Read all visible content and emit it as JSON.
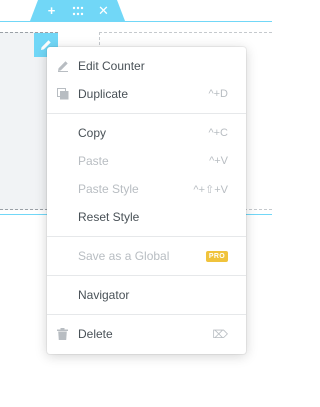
{
  "section_handle": {
    "add_glyph": "+",
    "drag_glyph": "⋮⋮",
    "close_glyph": "✕"
  },
  "context_menu": {
    "groups": [
      {
        "items": [
          {
            "label": "Edit Counter",
            "shortcut": "",
            "icon": "pencil-icon",
            "disabled": false
          },
          {
            "label": "Duplicate",
            "shortcut": "^+D",
            "icon": "duplicate-icon",
            "disabled": false
          }
        ]
      },
      {
        "items": [
          {
            "label": "Copy",
            "shortcut": "^+C",
            "disabled": false
          },
          {
            "label": "Paste",
            "shortcut": "^+V",
            "disabled": true
          },
          {
            "label": "Paste Style",
            "shortcut": "^+⇧+V",
            "disabled": true
          },
          {
            "label": "Reset Style",
            "shortcut": "",
            "disabled": false
          }
        ]
      },
      {
        "items": [
          {
            "label": "Save as a Global",
            "badge": "PRO",
            "disabled": true
          }
        ]
      },
      {
        "items": [
          {
            "label": "Navigator",
            "disabled": false
          }
        ]
      },
      {
        "items": [
          {
            "label": "Delete",
            "shortcut": "⌦",
            "icon": "trash-icon",
            "disabled": false
          }
        ]
      }
    ]
  },
  "colors": {
    "accent": "#71d7f7",
    "text": "#495157",
    "disabled_text": "#b8bdc2",
    "pro_badge": "#f0c33c"
  }
}
